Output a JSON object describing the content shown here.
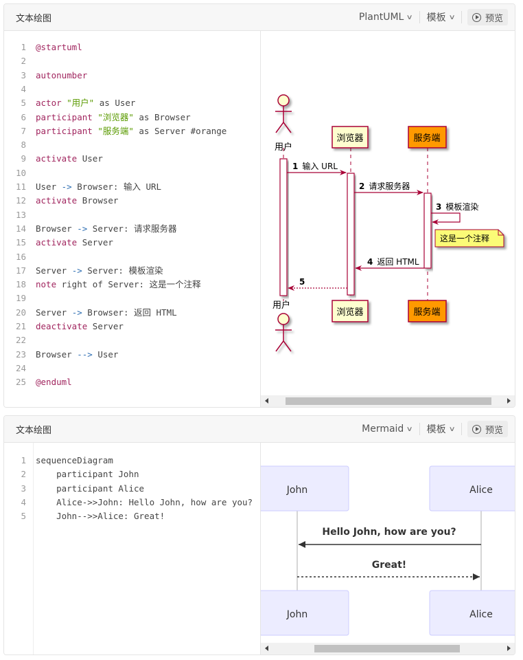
{
  "panel1": {
    "title": "文本绘图",
    "language": "PlantUML",
    "template_label": "模板",
    "preview_label": "预览",
    "code_lines": [
      [
        {
          "t": "@startuml",
          "c": "kw"
        }
      ],
      [],
      [
        {
          "t": "autonumber",
          "c": "kw"
        }
      ],
      [],
      [
        {
          "t": "actor ",
          "c": "kw"
        },
        {
          "t": "\"用户\"",
          "c": "str"
        },
        {
          "t": " as User",
          "c": "txt"
        }
      ],
      [
        {
          "t": "participant ",
          "c": "kw"
        },
        {
          "t": "\"浏览器\"",
          "c": "str"
        },
        {
          "t": " as Browser",
          "c": "txt"
        }
      ],
      [
        {
          "t": "participant ",
          "c": "kw"
        },
        {
          "t": "\"服务端\"",
          "c": "str"
        },
        {
          "t": " as Server #orange",
          "c": "txt"
        }
      ],
      [],
      [
        {
          "t": "activate",
          "c": "kw"
        },
        {
          "t": " User",
          "c": "txt"
        }
      ],
      [],
      [
        {
          "t": "User ",
          "c": "txt"
        },
        {
          "t": "->",
          "c": "arr"
        },
        {
          "t": " Browser: 输入 URL",
          "c": "txt"
        }
      ],
      [
        {
          "t": "activate",
          "c": "kw"
        },
        {
          "t": " Browser",
          "c": "txt"
        }
      ],
      [],
      [
        {
          "t": "Browser ",
          "c": "txt"
        },
        {
          "t": "->",
          "c": "arr"
        },
        {
          "t": " Server: 请求服务器",
          "c": "txt"
        }
      ],
      [
        {
          "t": "activate",
          "c": "kw"
        },
        {
          "t": " Server",
          "c": "txt"
        }
      ],
      [],
      [
        {
          "t": "Server ",
          "c": "txt"
        },
        {
          "t": "->",
          "c": "arr"
        },
        {
          "t": " Server: 模板渲染",
          "c": "txt"
        }
      ],
      [
        {
          "t": "note",
          "c": "kw"
        },
        {
          "t": " right of Server: 这是一个注释",
          "c": "txt"
        }
      ],
      [],
      [
        {
          "t": "Server ",
          "c": "txt"
        },
        {
          "t": "->",
          "c": "arr"
        },
        {
          "t": " Browser: 返回 HTML",
          "c": "txt"
        }
      ],
      [
        {
          "t": "deactivate",
          "c": "kw"
        },
        {
          "t": " Server",
          "c": "txt"
        }
      ],
      [],
      [
        {
          "t": "Browser ",
          "c": "txt"
        },
        {
          "t": "-->",
          "c": "arr"
        },
        {
          "t": " User",
          "c": "txt"
        }
      ],
      [],
      [
        {
          "t": "@enduml",
          "c": "kw"
        }
      ]
    ],
    "diagram": {
      "actor_label": "用户",
      "browser_label": "浏览器",
      "server_label": "服务端",
      "server_color": "#ff9900",
      "participant_color": "#fefecf",
      "line_color": "#a80036",
      "note_color": "#fbfb77",
      "messages": [
        {
          "num": "1",
          "text": "输入 URL"
        },
        {
          "num": "2",
          "text": "请求服务器"
        },
        {
          "num": "3",
          "text": "模板渲染"
        },
        {
          "num": "4",
          "text": "返回 HTML"
        },
        {
          "num": "5",
          "text": ""
        }
      ],
      "note_text": "这是一个注释"
    }
  },
  "panel2": {
    "title": "文本绘图",
    "language": "Mermaid",
    "template_label": "模板",
    "preview_label": "预览",
    "code_lines": [
      [
        {
          "t": "sequenceDiagram",
          "c": "txt"
        }
      ],
      [
        {
          "t": "    participant John",
          "c": "txt"
        }
      ],
      [
        {
          "t": "    participant Alice",
          "c": "txt"
        }
      ],
      [
        {
          "t": "    Alice->>John: Hello John, how are you?",
          "c": "txt"
        }
      ],
      [
        {
          "t": "    John-->>Alice: Great!",
          "c": "txt"
        }
      ]
    ],
    "diagram": {
      "participant_a": "John",
      "participant_b": "Alice",
      "box_color": "#ececff",
      "border_color": "#ccccff",
      "message_1": "Hello John, how are you?",
      "message_2": "Great!"
    }
  }
}
